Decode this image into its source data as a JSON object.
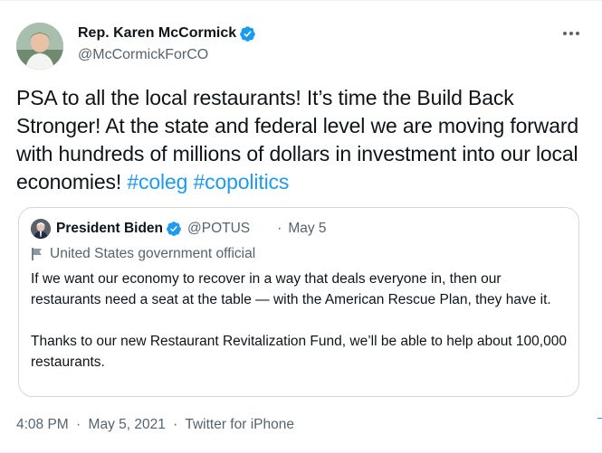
{
  "tweet": {
    "author": {
      "name": "Rep. Karen McCormick",
      "handle": "@McCormickForCO",
      "verified": true,
      "avatar": "avatar-photo"
    },
    "more_icon": "more-horizontal-icon",
    "text_main": "PSA to all the local restaurants! It’s time the Build Back Stronger! At the state and federal level we are moving forward with hundreds of millions of dollars in investment into our local economies! ",
    "hashtags": [
      "#coleg",
      "#copolitics"
    ],
    "timestamp": "4:08 PM",
    "date": "May 5, 2021",
    "source": "Twitter for iPhone",
    "separator": "·"
  },
  "quoted_tweet": {
    "author": {
      "name": "President Biden",
      "handle": "@POTUS",
      "verified": true
    },
    "separator": "·",
    "date": "May 5",
    "label_icon": "flag-icon",
    "label": "United States government official",
    "paragraphs": [
      "If we want our economy to recover in a way that deals everyone in, then our restaurants need a seat at the table — with the American Rescue Plan, they have it.",
      "Thanks to our new Restaurant Revitalization Fund, we’ll be able to help about 100,000 restaurants."
    ]
  },
  "colors": {
    "accent": "#1d9bf0",
    "text": "#0f1419",
    "secondary": "#536471",
    "border": "#cfd9de"
  }
}
